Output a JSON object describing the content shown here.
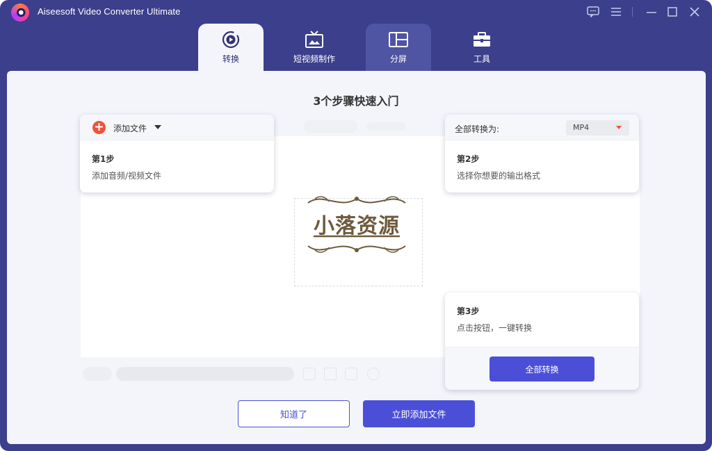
{
  "app": {
    "title": "Aiseesoft Video Converter Ultimate"
  },
  "title_controls": [
    "feedback-icon",
    "menu-icon",
    "minimize-icon",
    "maximize-icon",
    "close-icon"
  ],
  "tabs": [
    {
      "label": "转换",
      "icon": "convert-icon",
      "state": "active"
    },
    {
      "label": "短视频制作",
      "icon": "mv-icon",
      "state": "normal"
    },
    {
      "label": "分屏",
      "icon": "collage-icon",
      "state": "hover"
    },
    {
      "label": "工具",
      "icon": "toolbox-icon",
      "state": "normal"
    }
  ],
  "guide": {
    "title": "3个步骤快速入门",
    "step1": {
      "add_label": "添加文件",
      "title": "第1步",
      "desc": "添加音频/视频文件"
    },
    "step2": {
      "convert_to_label": "全部转换为:",
      "format": "MP4",
      "title": "第2步",
      "desc": "选择你想要的输出格式"
    },
    "step3": {
      "title": "第3步",
      "desc": "点击按钮，一键转换",
      "button": "全部转换"
    }
  },
  "buttons": {
    "got_it": "知道了",
    "add_now": "立即添加文件"
  },
  "watermark": {
    "text": "小落资源"
  },
  "colors": {
    "frame": "#3b3f8c",
    "accent": "#4b4fd8",
    "add_icon": "#f0533a",
    "content_bg": "#f4f5fb"
  }
}
